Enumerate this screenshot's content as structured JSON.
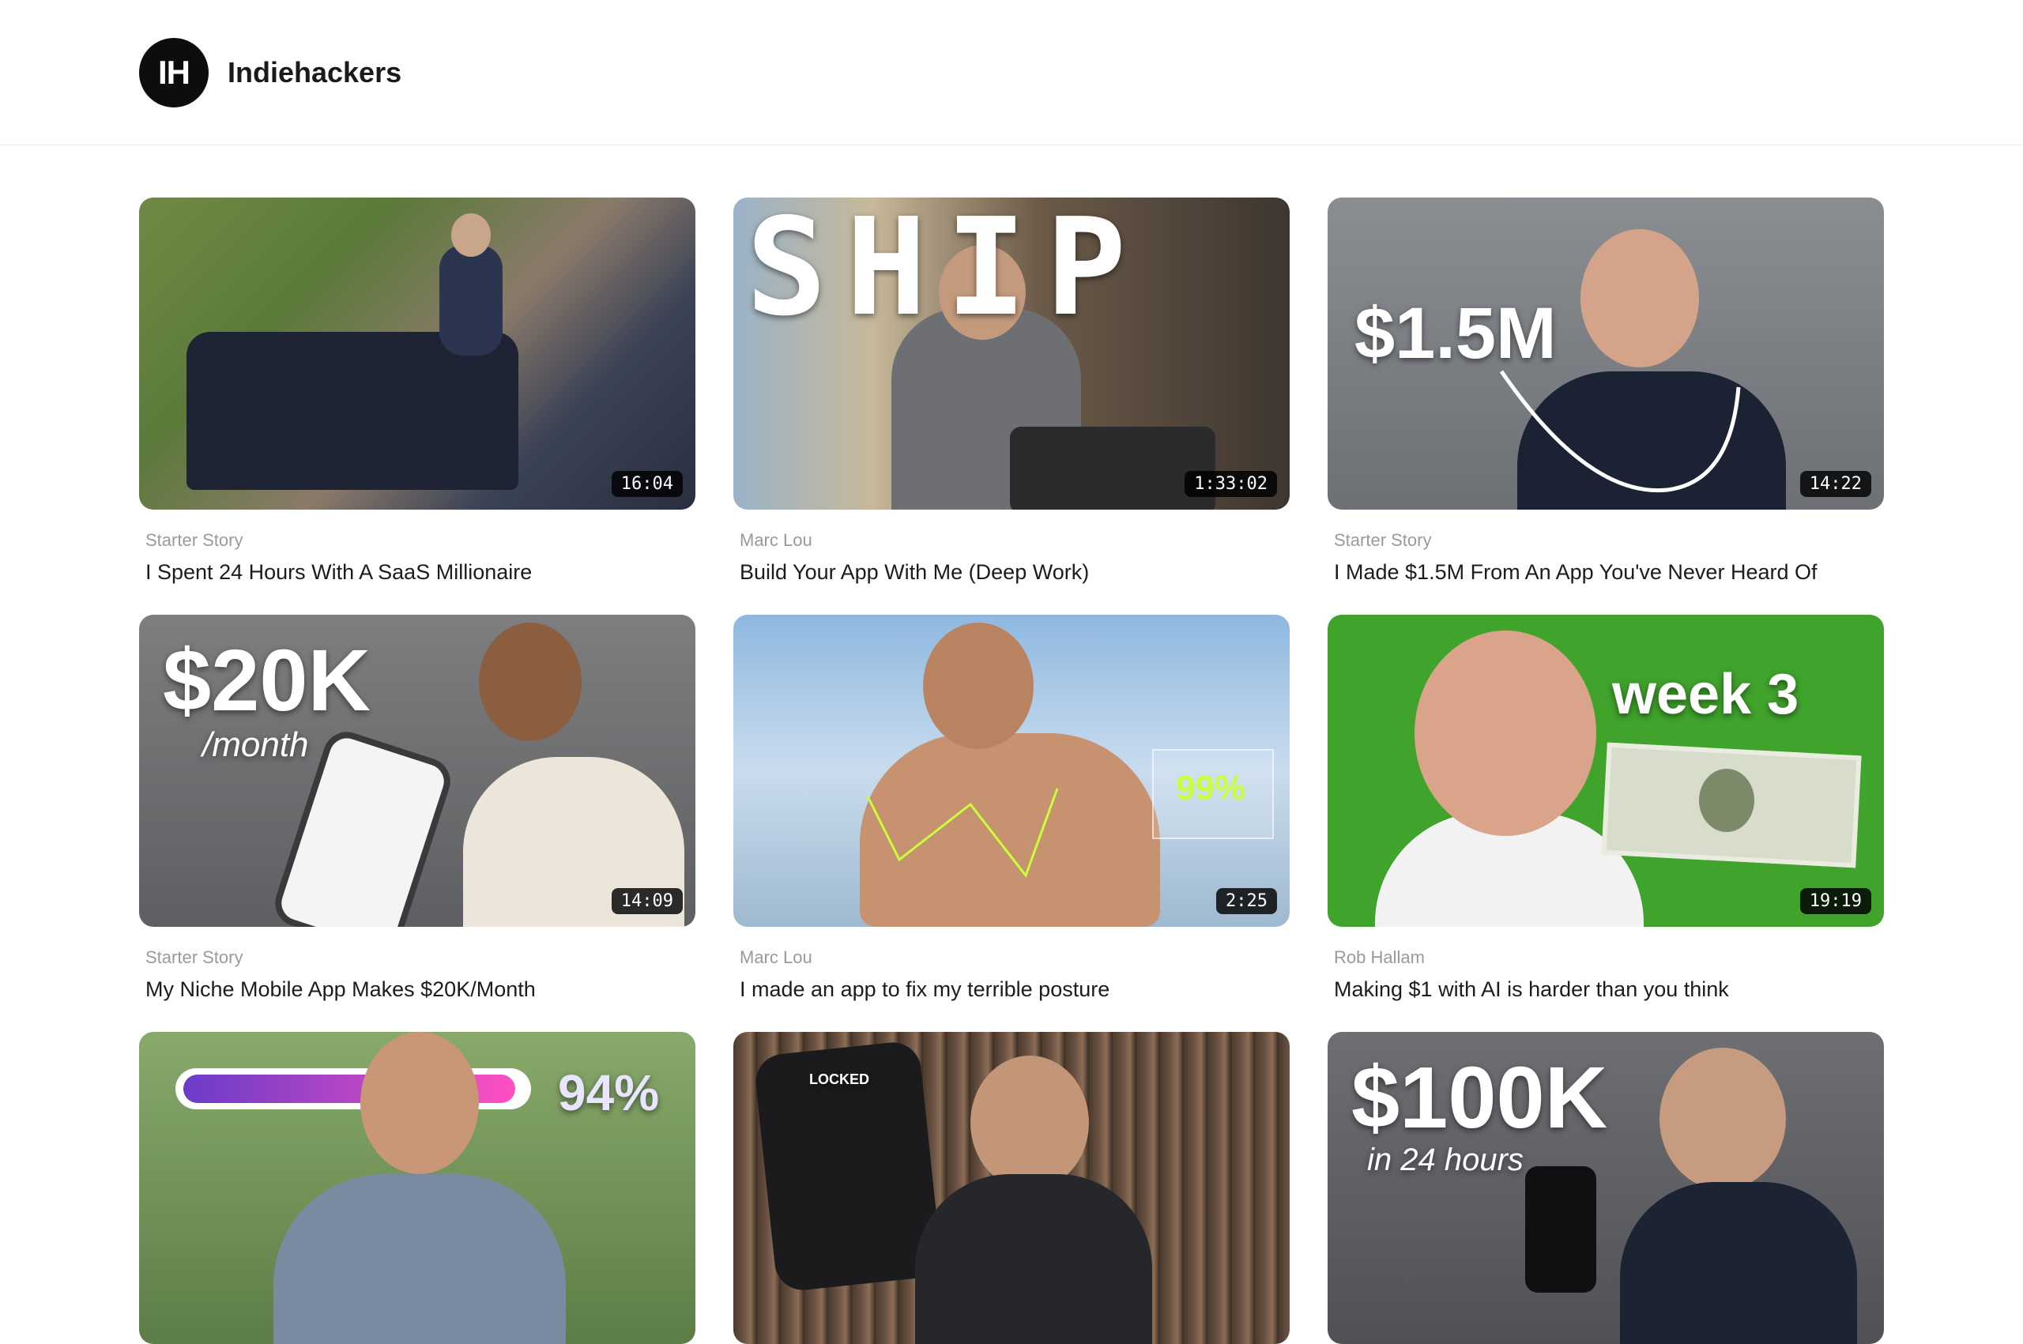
{
  "header": {
    "logo_text": "IH",
    "brand": "Indiehackers"
  },
  "videos": [
    {
      "channel": "Starter Story",
      "title": "I Spent 24 Hours With A SaaS Millionaire",
      "duration": "16:04"
    },
    {
      "channel": "Marc Lou",
      "title": "Build Your App With Me (Deep Work)",
      "duration": "1:33:02",
      "overlay_text": "SHIP"
    },
    {
      "channel": "Starter Story",
      "title": "I Made $1.5M From An App You've Never Heard Of",
      "duration": "14:22",
      "overlay_text": "$1.5M"
    },
    {
      "channel": "Starter Story",
      "title": "My Niche Mobile App Makes $20K/Month",
      "duration": "14:09",
      "overlay_text": "$20K",
      "overlay_sub": "/month"
    },
    {
      "channel": "Marc Lou",
      "title": "I made an app to fix my terrible posture",
      "duration": "2:25",
      "overlay_text": "99%"
    },
    {
      "channel": "Rob Hallam",
      "title": "Making $1 with AI is harder than you think",
      "duration": "19:19",
      "overlay_text": "week 3"
    },
    {
      "overlay_text": "94%"
    },
    {
      "overlay_text": "LOCKED"
    },
    {
      "overlay_text": "$100K",
      "overlay_sub": "in 24 hours"
    }
  ],
  "colors": {
    "accent": "#0d0d0d",
    "channel": "#9a9a9a",
    "green_screen": "#3fa32c"
  }
}
